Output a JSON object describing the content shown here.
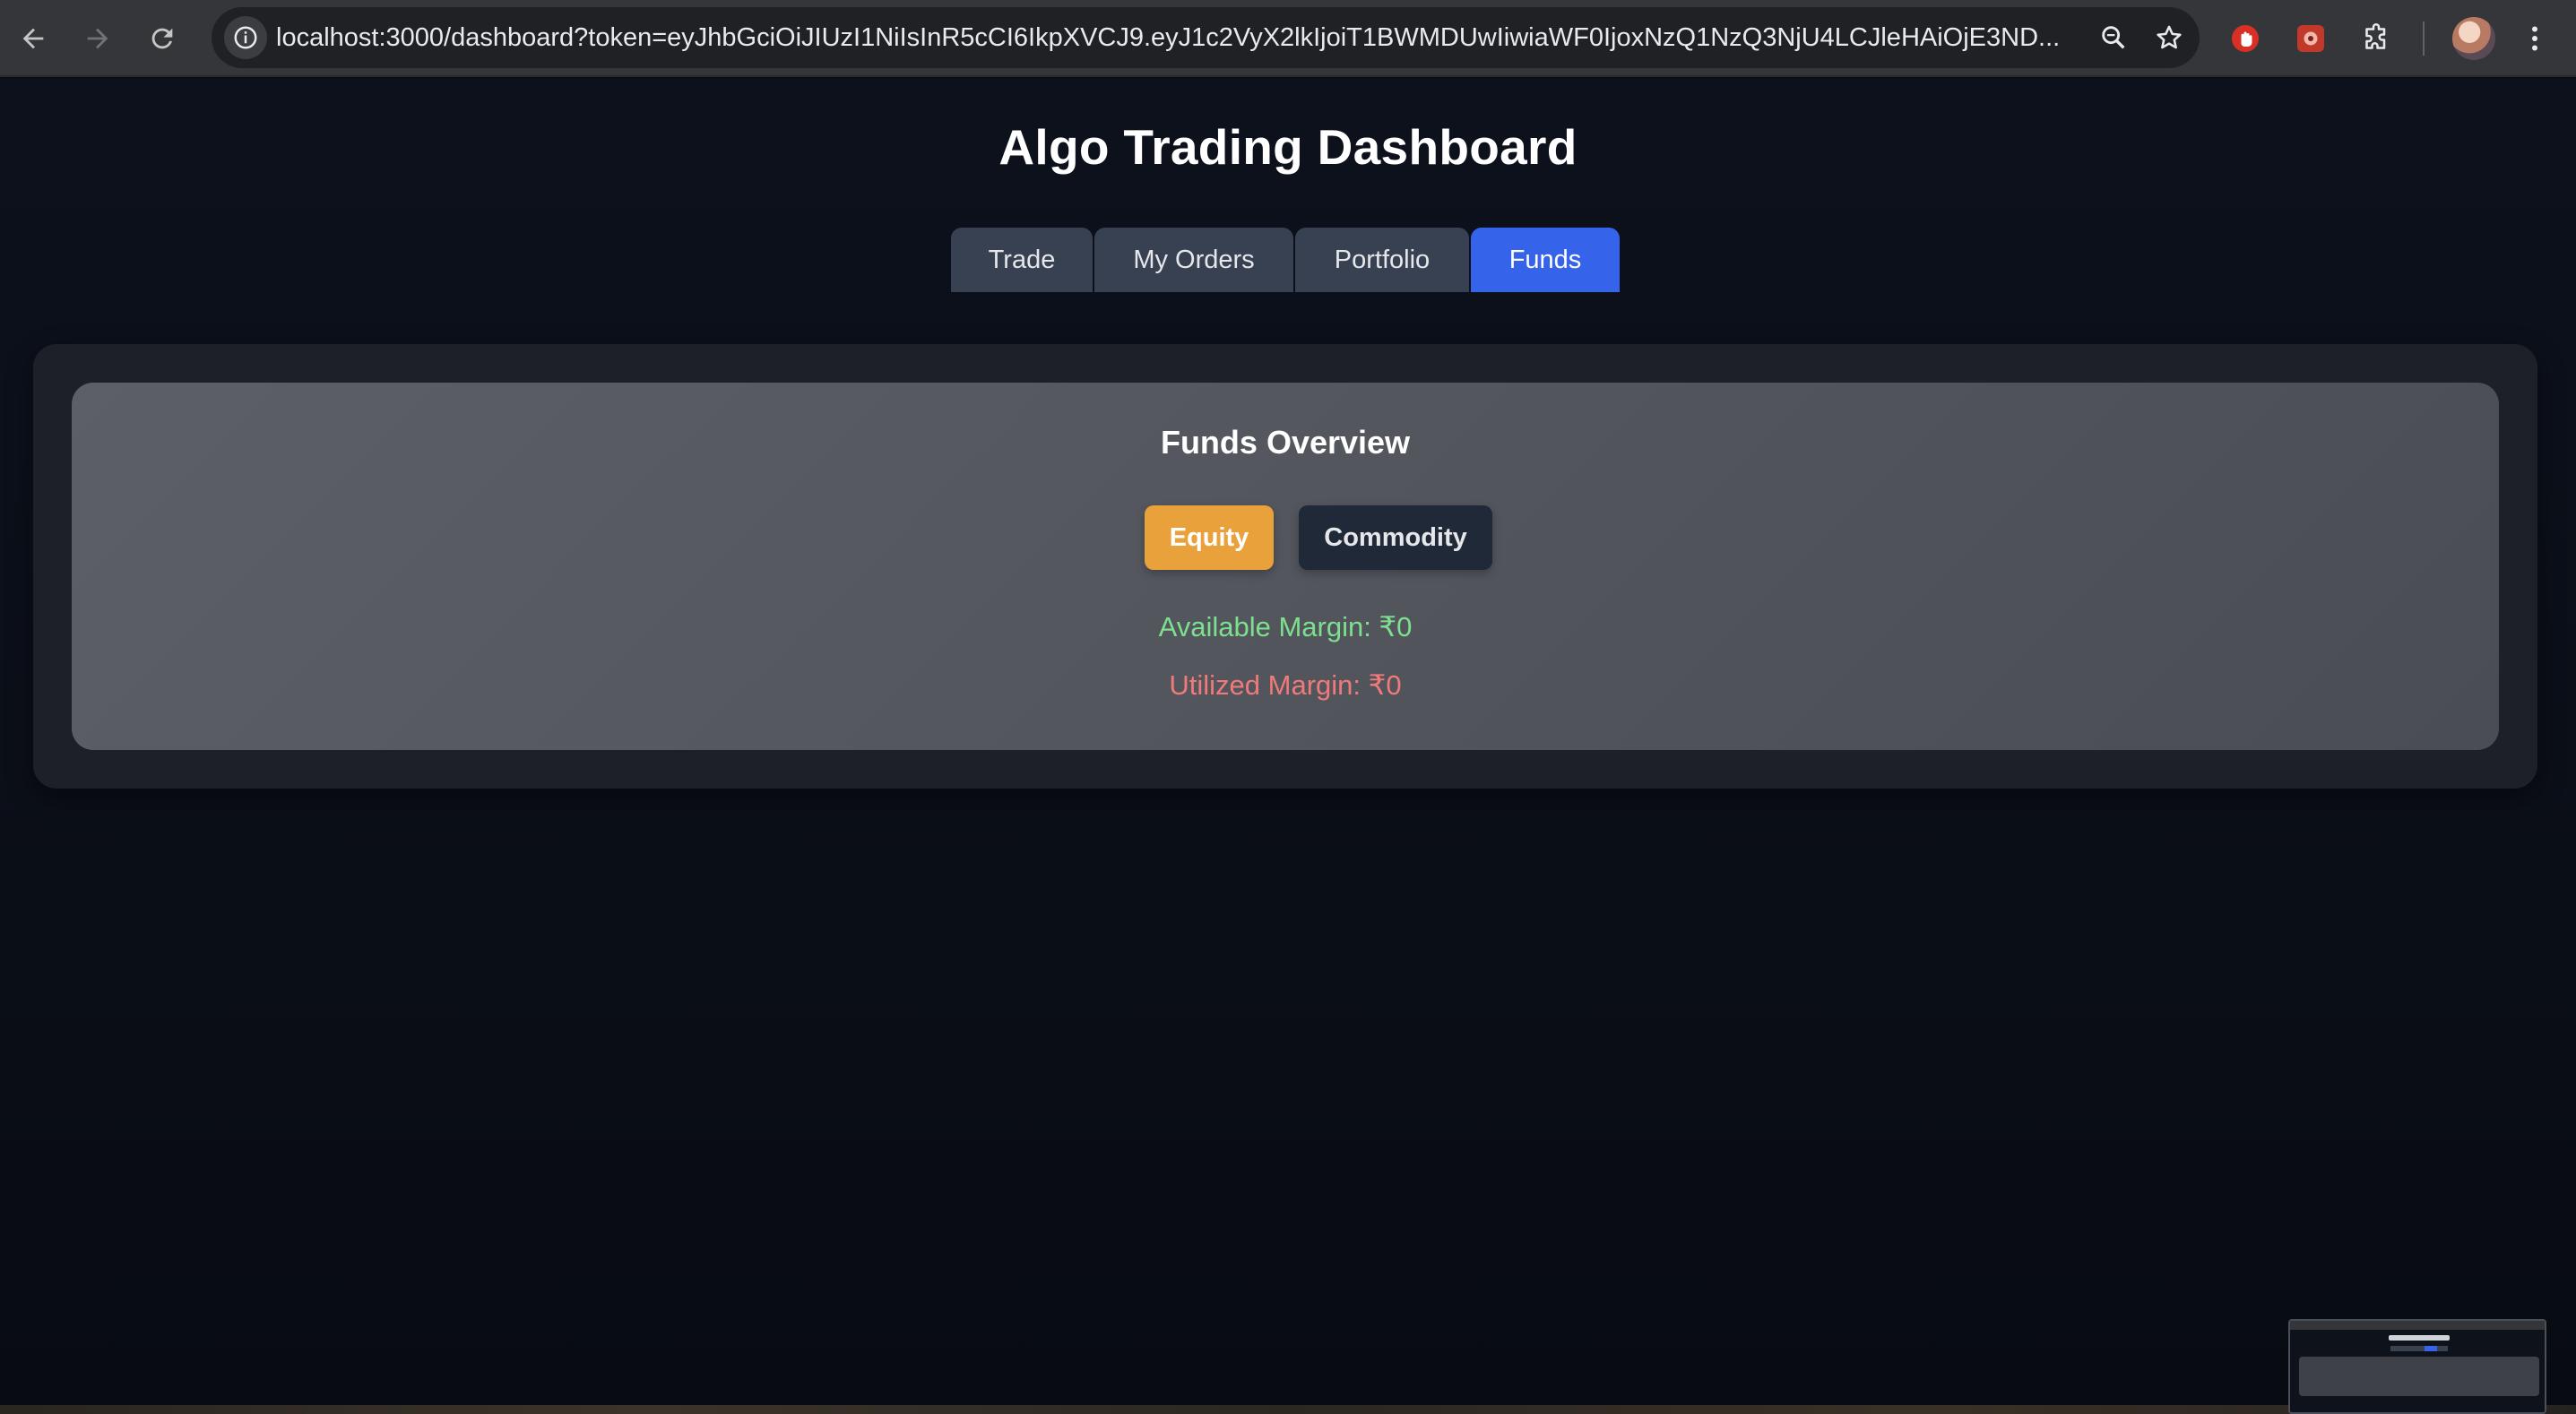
{
  "browser": {
    "url": "localhost:3000/dashboard?token=eyJhbGciOiJIUzI1NiIsInR5cCI6IkpXVCJ9.eyJ1c2VyX2lkIjoiT1BWMDUwIiwiaWF0IjoxNzQ1NzQ3NjU4LCJleHAiOjE3ND..."
  },
  "header": {
    "title": "Algo Trading Dashboard"
  },
  "tabs": [
    {
      "label": "Trade",
      "active": false
    },
    {
      "label": "My Orders",
      "active": false
    },
    {
      "label": "Portfolio",
      "active": false
    },
    {
      "label": "Funds",
      "active": true
    }
  ],
  "funds": {
    "title": "Funds Overview",
    "segments": [
      {
        "label": "Equity",
        "selected": true
      },
      {
        "label": "Commodity",
        "selected": false
      }
    ],
    "available_margin": "Available Margin: ₹0",
    "utilized_margin": "Utilized Margin: ₹0"
  },
  "colors": {
    "active_tab": "#3563e9",
    "selected_segment": "#e9a23b",
    "available_margin": "#7ee08e",
    "utilized_margin": "#f07a7a"
  }
}
